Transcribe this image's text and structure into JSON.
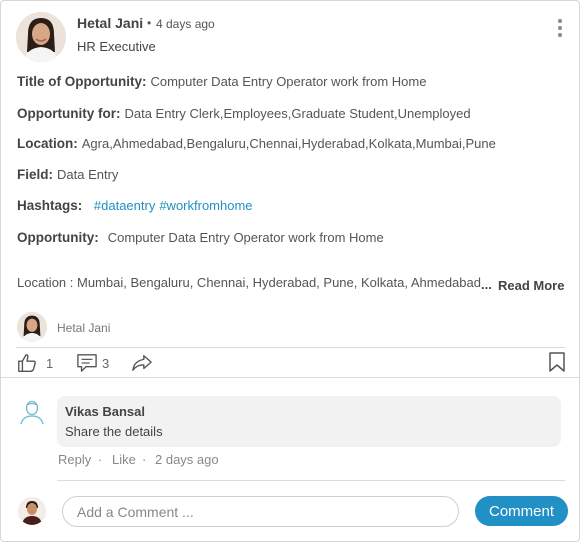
{
  "post": {
    "author": "Hetal Jani",
    "dot": "•",
    "time": "4 days ago",
    "role": "HR Executive"
  },
  "details": {
    "title_label": "Title of Opportunity:",
    "title_value": "Computer Data Entry Operator work from Home",
    "for_label": "Opportunity for:",
    "for_value": "Data Entry Clerk,Employees,Graduate Student,Unemployed",
    "location_label": "Location:",
    "location_value": "Agra,Ahmedabad,Bengaluru,Chennai,Hyderabad,Kolkata,Mumbai,Pune",
    "field_label": "Field:",
    "field_value": "Data Entry",
    "hashtags_label": "Hashtags:",
    "hashtags": [
      "#dataentry",
      "#workfromhome"
    ],
    "opportunity_label": "Opportunity:",
    "opportunity_value": "Computer Data Entry Operator work from Home",
    "excerpt": "Location : Mumbai, Bengaluru, Chennai, Hyderabad, Pune, Kolkata, Ahmedabad",
    "ellipsis": "...",
    "read_more": "Read More",
    "author_small": "Hetal Jani"
  },
  "actions": {
    "likes": "1",
    "comments": "3"
  },
  "comment": {
    "name": "Vikas Bansal",
    "text": "Share the details",
    "reply": "Reply",
    "sep": "·",
    "like": "Like",
    "time": "2 days ago"
  },
  "composer": {
    "placeholder": "Add a Comment ...",
    "button": "Comment"
  },
  "colors": {
    "accent": "#2190c4",
    "text": "#444444",
    "muted": "#888888"
  },
  "icons": [
    "kebab-menu-icon",
    "thumbs-up-icon",
    "comment-icon",
    "share-icon",
    "bookmark-icon",
    "user-outline-icon"
  ]
}
